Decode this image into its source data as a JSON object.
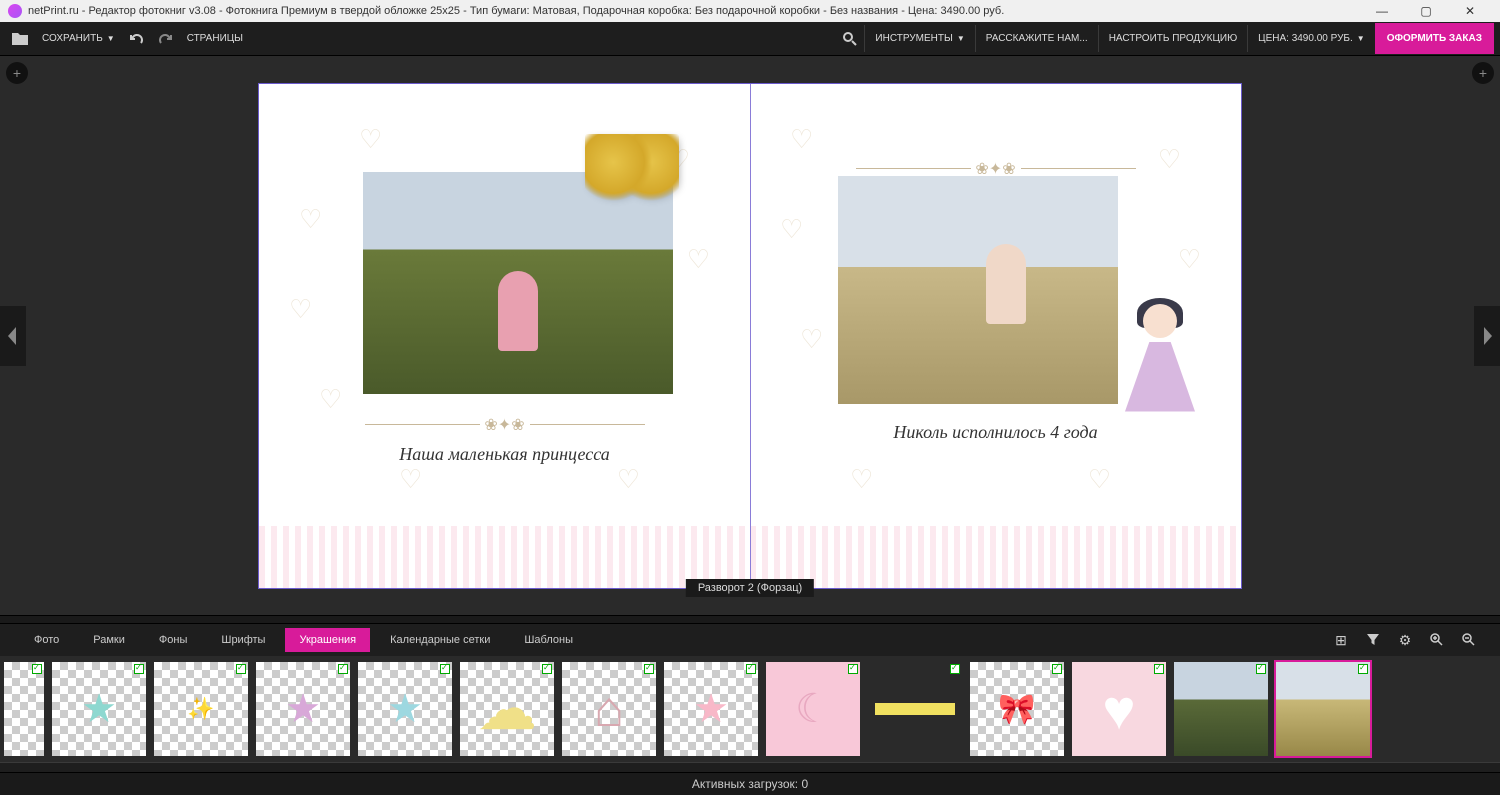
{
  "titlebar": {
    "text": "netPrint.ru - Редактор фотокниг v3.08 - Фотокнига Премиум в твердой обложке 25x25 - Тип бумаги: Матовая, Подарочная коробка: Без подарочной коробки - Без названия - Цена: 3490.00 руб."
  },
  "toolbar": {
    "save": "СОХРАНИТЬ",
    "pages": "СТРАНИЦЫ",
    "tools": "ИНСТРУМЕНТЫ",
    "tell_us": "РАССКАЖИТЕ НАМ...",
    "configure": "НАСТРОИТЬ ПРОДУКЦИЮ",
    "price": "ЦЕНА: 3490.00 РУБ.",
    "cta": "ОФОРМИТЬ ЗАКАЗ"
  },
  "spread": {
    "caption_left": "Наша маленькая принцесса",
    "caption_right": "Николь исполнилось 4 года",
    "label": "Разворот 2 (Форзац)"
  },
  "tabs": {
    "items": [
      "Фото",
      "Рамки",
      "Фоны",
      "Шрифты",
      "Украшения",
      "Календарные сетки",
      "Шаблоны"
    ],
    "active": 4
  },
  "status": "Активных загрузок: 0"
}
